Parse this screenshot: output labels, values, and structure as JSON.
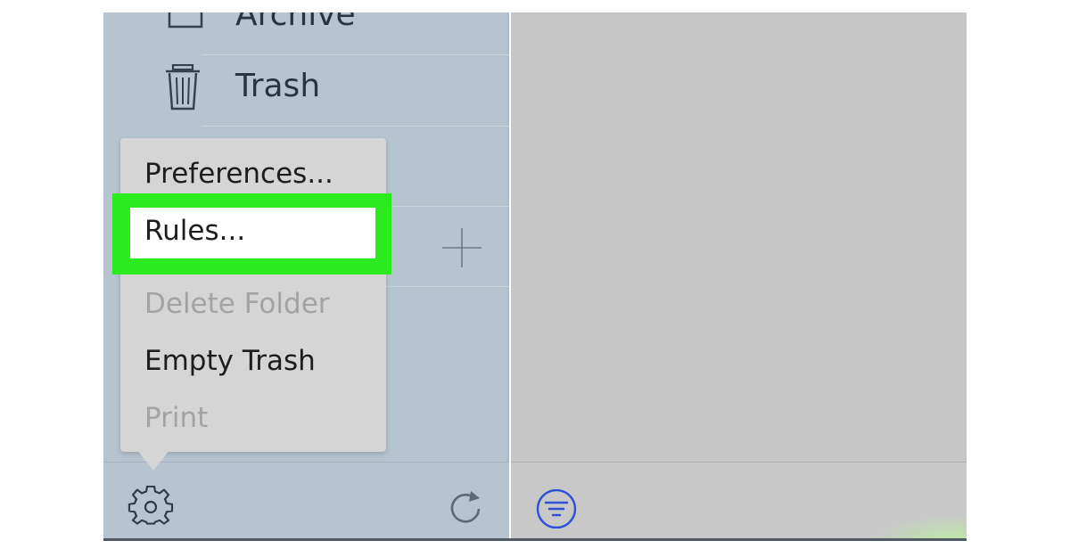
{
  "sidebar": {
    "items": [
      {
        "label": "Archive",
        "icon": "archive-icon"
      },
      {
        "label": "Trash",
        "icon": "trash-icon"
      }
    ],
    "add_icon": "plus-icon",
    "toolbar": {
      "settings_icon": "gear-icon",
      "refresh_icon": "refresh-icon"
    }
  },
  "content_toolbar": {
    "filter_icon": "filter-icon"
  },
  "menu": {
    "items": [
      {
        "label": "Preferences...",
        "enabled": true
      },
      {
        "label": "Rules...",
        "enabled": true,
        "highlighted": true
      },
      {
        "label": "Delete Folder",
        "enabled": false
      },
      {
        "label": "Empty Trash",
        "enabled": true
      },
      {
        "label": "Print",
        "enabled": false
      }
    ]
  },
  "colors": {
    "sidebar_bg": "#b7c4cf",
    "content_bg": "#c6c6c6",
    "menu_bg": "#d5d5d5",
    "highlight": "#2bea1e",
    "accent_blue": "#2f4fd6",
    "disabled_text": "#a3a3a3"
  }
}
